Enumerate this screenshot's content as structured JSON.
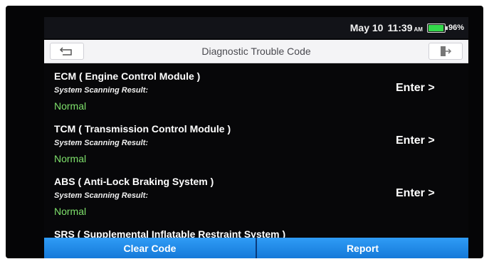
{
  "status_bar": {
    "date": "May 10",
    "time": "11:39",
    "ampm": "AM",
    "battery_percent": "96%",
    "battery_level": 0.96
  },
  "title_bar": {
    "title": "Diagnostic Trouble Code",
    "back_icon": "back-arrow-icon",
    "exit_icon": "exit-icon"
  },
  "modules": [
    {
      "name": "ECM ( Engine Control Module )",
      "result_label": "System Scanning Result:",
      "status": "Normal",
      "enter_label": "Enter >"
    },
    {
      "name": "TCM ( Transmission Control Module )",
      "result_label": "System Scanning Result:",
      "status": "Normal",
      "enter_label": "Enter >"
    },
    {
      "name": "ABS ( Anti-Lock Braking System )",
      "result_label": "System Scanning Result:",
      "status": "Normal",
      "enter_label": "Enter >"
    },
    {
      "name": "SRS ( Supplemental Inflatable Restraint System )",
      "result_label": "",
      "status": "",
      "enter_label": ""
    }
  ],
  "bottom_bar": {
    "clear_code_label": "Clear Code",
    "report_label": "Report"
  },
  "colors": {
    "status_normal": "#7ee06b",
    "button_blue": "#1d87e6",
    "battery_green": "#33d84a"
  }
}
